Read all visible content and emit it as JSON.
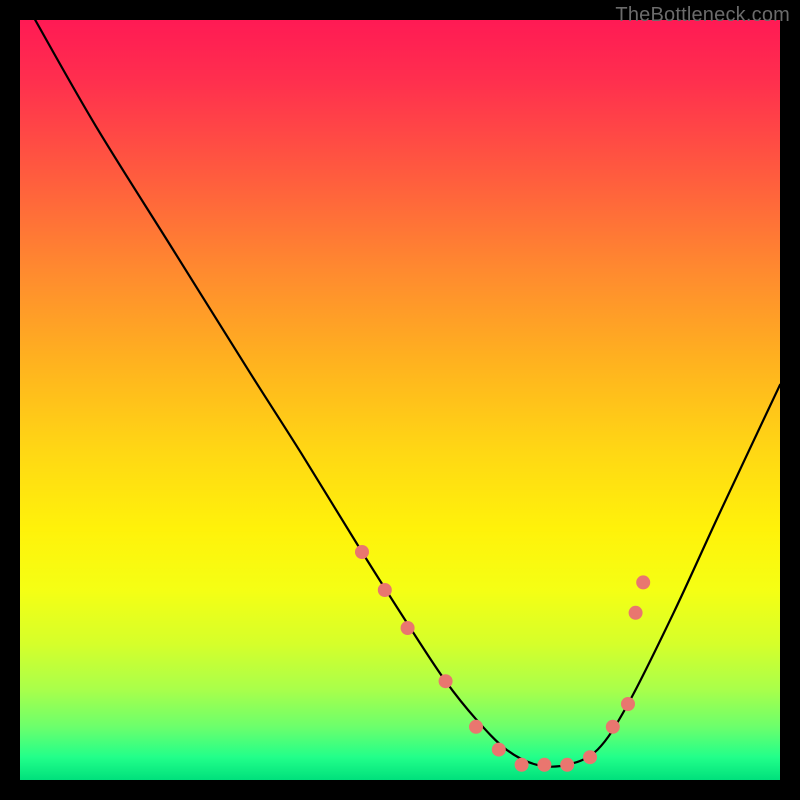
{
  "watermark": "TheBottleneck.com",
  "chart_data": {
    "type": "line",
    "title": "",
    "xlabel": "",
    "ylabel": "",
    "xlim": [
      0,
      100
    ],
    "ylim": [
      0,
      100
    ],
    "series": [
      {
        "name": "bottleneck-curve",
        "x": [
          2,
          10,
          20,
          30,
          37,
          45,
          52,
          56,
          60,
          64,
          68,
          72,
          76,
          80,
          86,
          92,
          100
        ],
        "y": [
          100,
          86,
          70,
          54,
          43,
          30,
          19,
          13,
          8,
          4,
          2,
          2,
          4,
          10,
          22,
          35,
          52
        ]
      }
    ],
    "markers": {
      "name": "highlighted-points",
      "color": "#e9766f",
      "x": [
        45,
        48,
        51,
        56,
        60,
        63,
        66,
        69,
        72,
        75,
        78,
        80,
        81,
        82
      ],
      "y": [
        30,
        25,
        20,
        13,
        7,
        4,
        2,
        2,
        2,
        3,
        7,
        10,
        22,
        26
      ]
    },
    "gradient_stops": [
      {
        "pos": 0,
        "color": "#ff1a54"
      },
      {
        "pos": 50,
        "color": "#ffd814"
      },
      {
        "pos": 75,
        "color": "#f5ff14"
      },
      {
        "pos": 100,
        "color": "#00e07c"
      }
    ]
  }
}
